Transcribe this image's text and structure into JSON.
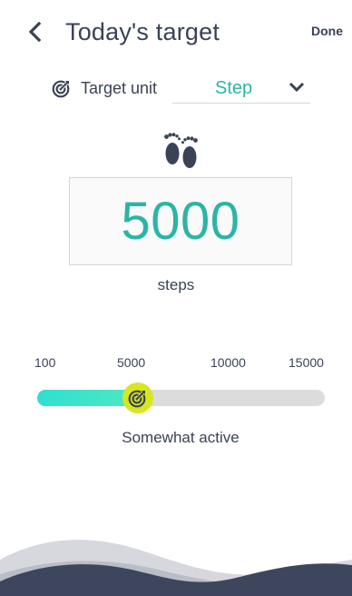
{
  "header": {
    "title": "Today's target",
    "done_label": "Done"
  },
  "target_unit": {
    "label": "Target unit",
    "selected": "Step"
  },
  "goal": {
    "value": "5000",
    "unit_label": "steps"
  },
  "slider": {
    "ticks": [
      "100",
      "5000",
      "10000",
      "15000"
    ],
    "min": 100,
    "max": 15000,
    "current": 5000,
    "level_label": "Somewhat active"
  },
  "colors": {
    "text": "#3a4256",
    "accent": "#2bb5a5",
    "slider_fill": "#2fe0d0",
    "thumb": "#d7e620",
    "wave_dark": "#3d465c",
    "wave_light": "#d6d8de"
  },
  "icons": {
    "back": "chevron-left-icon",
    "unit": "target-icon",
    "dropdown": "chevron-down-icon",
    "feet": "footprints-icon",
    "thumb": "target-icon"
  }
}
